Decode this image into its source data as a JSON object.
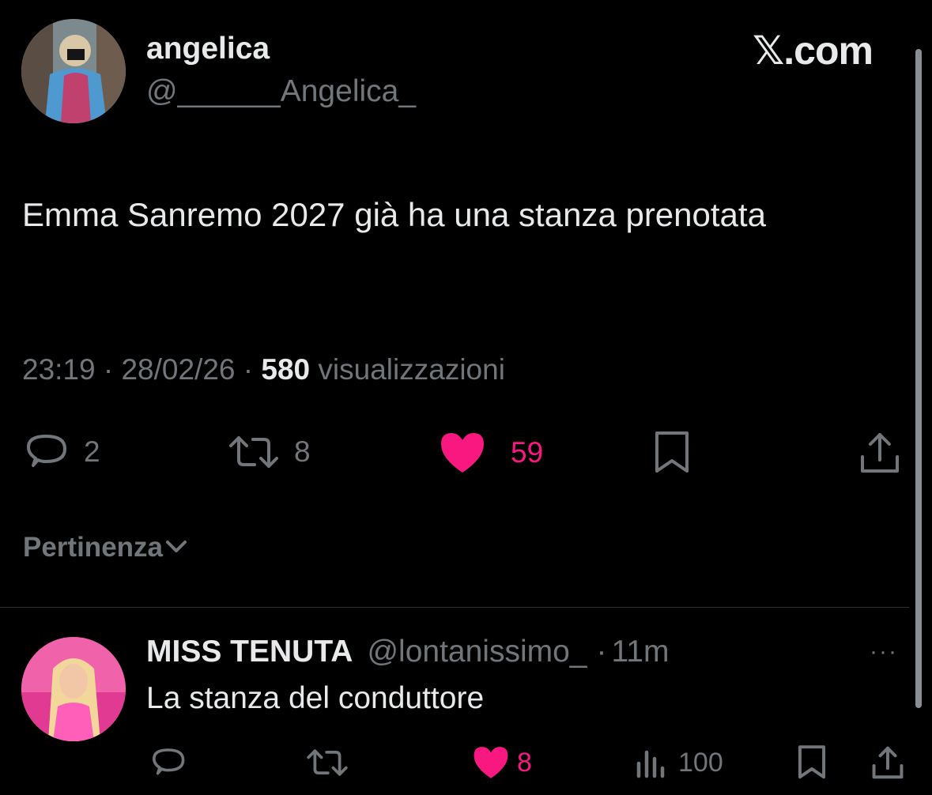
{
  "header": {
    "author_name": "angelica",
    "author_handle": "@______Angelica_",
    "brand": "𝕏.com"
  },
  "tweet": {
    "text": "Emma Sanremo 2027 già ha una stanza prenotata",
    "time": "23:19",
    "sep1": " · ",
    "date": "28/02/26",
    "sep2": " · ",
    "views_count": "580",
    "views_label": " visualizzazioni",
    "replies": "2",
    "retweets": "8",
    "likes": "59",
    "like_color": "#f91880",
    "icons": [
      "reply-icon",
      "retweet-icon",
      "heart-icon",
      "bookmark-icon",
      "share-icon"
    ]
  },
  "sort": {
    "label": "Pertinenza"
  },
  "reply": {
    "name": "MISS TENUTA",
    "handle": "@lontanissimo_",
    "dot": "·",
    "time": "11m",
    "more": "···",
    "text": "La stanza del conduttore",
    "likes": "8",
    "views": "100",
    "icons": [
      "reply-icon",
      "retweet-icon",
      "heart-icon",
      "views-icon",
      "bookmark-icon",
      "share-icon"
    ]
  }
}
